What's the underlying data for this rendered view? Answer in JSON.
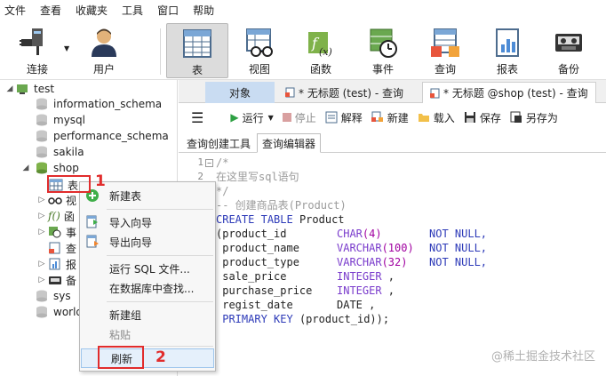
{
  "menu": [
    "文件",
    "查看",
    "收藏夹",
    "工具",
    "窗口",
    "帮助"
  ],
  "toolbar": {
    "connect": "连接",
    "user": "用户",
    "table": "表",
    "view": "视图",
    "function": "函数",
    "event": "事件",
    "query": "查询",
    "report": "报表",
    "backup": "备份"
  },
  "tree": {
    "root": "test",
    "db1": "information_schema",
    "db2": "mysql",
    "db3": "performance_schema",
    "db4": "sakila",
    "shop": "shop",
    "tables": "表",
    "views": "视",
    "functions": "函",
    "events": "事",
    "queries": "查",
    "reports": "报",
    "backups": "备",
    "sys": "sys",
    "world": "world"
  },
  "tabs": {
    "objects": "对象",
    "tab1": "* 无标题 (test) - 查询",
    "tab2": "* 无标题 @shop (test) - 查询"
  },
  "query_toolbar": {
    "run": "运行",
    "stop": "停止",
    "explain": "解释",
    "new": "新建",
    "load": "载入",
    "save": "保存",
    "save_as": "另存为"
  },
  "subtabs": {
    "builder": "查询创建工具",
    "editor": "查询编辑器"
  },
  "editor": {
    "line1": "/*",
    "line2": "在这里写sql语句",
    "line3": "*/",
    "line4": "-- 创建商品表(Product)",
    "kw_create": "CREATE",
    "kw_table": "TABLE",
    "table_name": "Product",
    "col1": "(product_id",
    "col1_type": "CHAR",
    "col1_len": "(4)",
    "col2": " product_name",
    "col2_type": "VARCHAR",
    "col2_len": "(100)",
    "col3": " product_type",
    "col3_type": "VARCHAR",
    "col3_len": "(32)",
    "col4": " sale_price",
    "col4_type": "INTEGER",
    "col5": " purchase_price",
    "col5_type": "INTEGER",
    "col6": " regist_date",
    "col6_type": "DATE",
    "pk_kw": "PRIMARY KEY",
    "pk_col": "(product_id));",
    "not_null": "NOT NULL,",
    "comma": " ,"
  },
  "context_menu": {
    "new_table": "新建表",
    "import_wizard": "导入向导",
    "export_wizard": "导出向导",
    "run_sql_file": "运行 SQL 文件...",
    "find_in_db": "在数据库中查找...",
    "new_group": "新建组",
    "paste": "粘贴",
    "refresh": "刷新"
  },
  "annotations": {
    "step1": "1",
    "step2": "2"
  },
  "watermark": "@稀土掘金技术社区",
  "colors": {
    "highlight": "#c9dcf2",
    "annotation": "#e12c2c",
    "keyword": "#2d3ab8"
  }
}
